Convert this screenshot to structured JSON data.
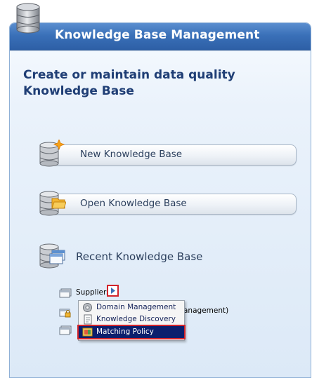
{
  "header": {
    "title": "Knowledge Base Management"
  },
  "main": {
    "subtitle": "Create or maintain data quality Knowledge Base",
    "actions": [
      {
        "label": "New Knowledge Base"
      },
      {
        "label": "Open Knowledge Base"
      }
    ],
    "recent": {
      "label": "Recent Knowledge Base",
      "items": [
        {
          "name": "Suppliers"
        },
        {
          "name": "anagement)"
        }
      ]
    }
  },
  "context_menu": {
    "items": [
      {
        "label": "Domain Management",
        "icon": "gear-icon",
        "selected": false
      },
      {
        "label": "Knowledge Discovery",
        "icon": "document-icon",
        "selected": false
      },
      {
        "label": "Matching Policy",
        "icon": "matching-policy-icon",
        "selected": true
      }
    ]
  },
  "colors": {
    "header_blue": "#3a70b8",
    "title_navy": "#1f3e75",
    "highlight_red": "#d2232a",
    "selected_navy": "#0c1f6d"
  }
}
